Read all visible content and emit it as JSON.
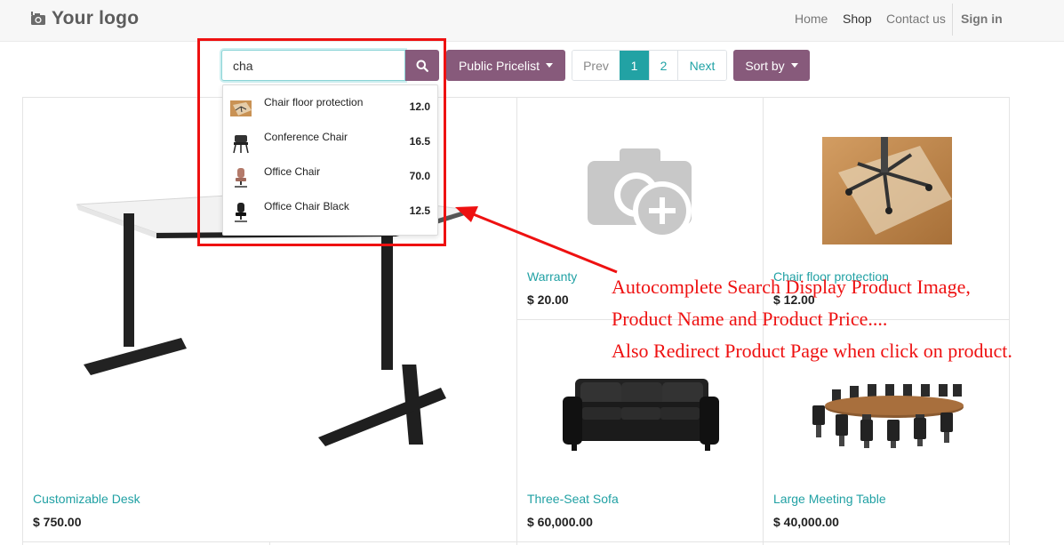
{
  "header": {
    "logo_text": "Your logo",
    "logo_icon": "camera-icon",
    "nav": {
      "home": "Home",
      "shop": "Shop",
      "contact": "Contact us"
    },
    "sign_in": "Sign in"
  },
  "search": {
    "value": "cha",
    "icon": "search-icon"
  },
  "pricelist": {
    "label": "Public Pricelist"
  },
  "pager": {
    "prev": "Prev",
    "page1": "1",
    "page2": "2",
    "next": "Next",
    "active_page": 1
  },
  "sort": {
    "label": "Sort by"
  },
  "autocomplete": {
    "items": [
      {
        "name": "Chair floor protection",
        "price": "12.0"
      },
      {
        "name": "Conference Chair",
        "price": "16.5"
      },
      {
        "name": "Office Chair",
        "price": "70.0"
      },
      {
        "name": "Office Chair Black",
        "price": "12.5"
      }
    ]
  },
  "products": [
    {
      "name": "Customizable Desk",
      "price": "$ 750.00"
    },
    {
      "name": "Warranty",
      "price": "$ 20.00"
    },
    {
      "name": "Chair floor protection",
      "price": "$ 12.00"
    },
    {
      "name": "Three-Seat Sofa",
      "price": "$ 60,000.00"
    },
    {
      "name": "Large Meeting Table",
      "price": "$ 40,000.00"
    }
  ],
  "annotation": {
    "line1": "Autocomplete Search Display Product Image,",
    "line2": "Product Name and Product Price....",
    "line3": "Also Redirect Product Page when click on product.",
    "color": "#ee1111"
  },
  "colors": {
    "accent_purple": "#875a7b",
    "accent_teal": "#21a3a6"
  }
}
